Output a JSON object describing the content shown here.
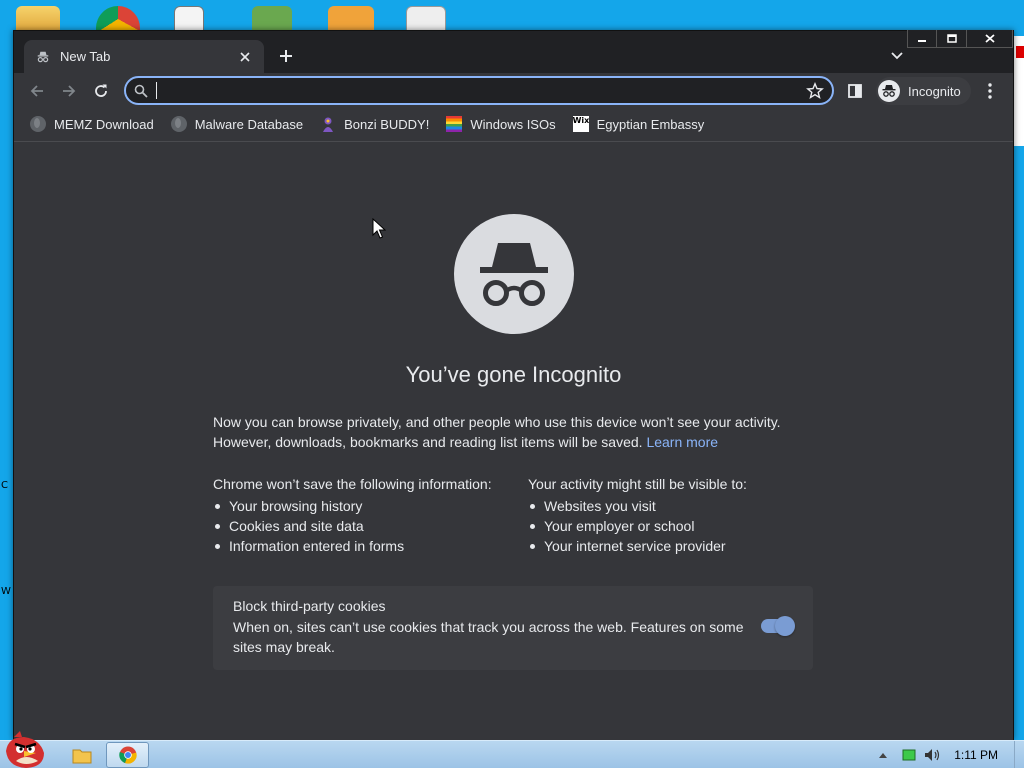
{
  "desktop": {
    "edge_letters": [
      "C",
      "W"
    ]
  },
  "browser": {
    "tab": {
      "title": "New Tab"
    },
    "omnibox": {
      "value": "",
      "placeholder": ""
    },
    "profile": {
      "label": "Incognito"
    },
    "bookmarks": [
      {
        "label": "MEMZ Download",
        "icon": "globe-icon"
      },
      {
        "label": "Malware Database",
        "icon": "globe-icon"
      },
      {
        "label": "Bonzi BUDDY!",
        "icon": "bonzi-icon"
      },
      {
        "label": "Windows ISOs",
        "icon": "rainbow-flag-icon"
      },
      {
        "label": "Egyptian Embassy",
        "icon": "wix-icon"
      }
    ]
  },
  "incognito": {
    "headline": "You’ve gone Incognito",
    "intro": "Now you can browse privately, and other people who use this device won’t see your activity. However, downloads, bookmarks and reading list items will be saved.",
    "learn_more": "Learn more",
    "not_saved": {
      "heading": "Chrome won’t save the following information:",
      "items": [
        "Your browsing history",
        "Cookies and site data",
        "Information entered in forms"
      ]
    },
    "visible_to": {
      "heading": "Your activity might still be visible to:",
      "items": [
        "Websites you visit",
        "Your employer or school",
        "Your internet service provider"
      ]
    },
    "cookies": {
      "title": "Block third-party cookies",
      "description": "When on, sites can’t use cookies that track you across the web. Features on some sites may break.",
      "enabled": true
    }
  },
  "taskbar": {
    "time": "1:11 PM"
  },
  "colors": {
    "accent": "#8ab4f8",
    "page_bg": "#35363a",
    "frame": "#202124",
    "desktop": "#14a6ea"
  }
}
